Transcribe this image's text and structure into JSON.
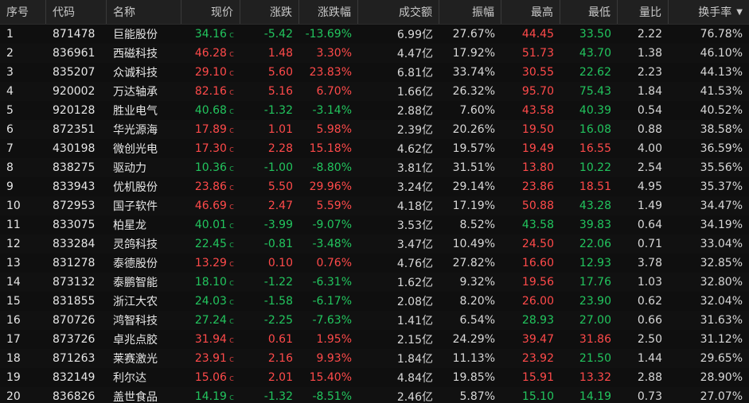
{
  "headers": [
    {
      "key": "idx",
      "label": "序号"
    },
    {
      "key": "code",
      "label": "代码"
    },
    {
      "key": "name",
      "label": "名称"
    },
    {
      "key": "price",
      "label": "现价"
    },
    {
      "key": "change",
      "label": "涨跌"
    },
    {
      "key": "pct",
      "label": "涨跌幅"
    },
    {
      "key": "turnover",
      "label": "成交额"
    },
    {
      "key": "amplitude",
      "label": "振幅"
    },
    {
      "key": "high",
      "label": "最高"
    },
    {
      "key": "low",
      "label": "最低"
    },
    {
      "key": "volratio",
      "label": "量比"
    },
    {
      "key": "turnrate",
      "label": "换手率",
      "sorted": "desc",
      "sort_icon": "▼"
    }
  ],
  "price_suffix": "c",
  "rows": [
    {
      "idx": "1",
      "code": "871478",
      "name": "巨能股份",
      "price": "34.16",
      "change": "-5.42",
      "pct": "-13.69%",
      "turnover": "6.99亿",
      "amplitude": "27.67%",
      "high": "44.45",
      "low": "33.50",
      "volratio": "2.22",
      "turnrate": "76.78%",
      "price_dir": "down",
      "change_dir": "down",
      "high_dir": "up",
      "low_dir": "down"
    },
    {
      "idx": "2",
      "code": "836961",
      "name": "西磁科技",
      "price": "46.28",
      "change": "1.48",
      "pct": "3.30%",
      "turnover": "4.47亿",
      "amplitude": "17.92%",
      "high": "51.73",
      "low": "43.70",
      "volratio": "1.38",
      "turnrate": "46.10%",
      "price_dir": "up",
      "change_dir": "up",
      "high_dir": "up",
      "low_dir": "down"
    },
    {
      "idx": "3",
      "code": "835207",
      "name": "众诚科技",
      "price": "29.10",
      "change": "5.60",
      "pct": "23.83%",
      "turnover": "6.81亿",
      "amplitude": "33.74%",
      "high": "30.55",
      "low": "22.62",
      "volratio": "2.23",
      "turnrate": "44.13%",
      "price_dir": "up",
      "change_dir": "up",
      "high_dir": "up",
      "low_dir": "down"
    },
    {
      "idx": "4",
      "code": "920002",
      "name": "万达轴承",
      "price": "82.16",
      "change": "5.16",
      "pct": "6.70%",
      "turnover": "1.66亿",
      "amplitude": "26.32%",
      "high": "95.70",
      "low": "75.43",
      "volratio": "1.84",
      "turnrate": "41.53%",
      "price_dir": "up",
      "change_dir": "up",
      "high_dir": "up",
      "low_dir": "down"
    },
    {
      "idx": "5",
      "code": "920128",
      "name": "胜业电气",
      "price": "40.68",
      "change": "-1.32",
      "pct": "-3.14%",
      "turnover": "2.88亿",
      "amplitude": "7.60%",
      "high": "43.58",
      "low": "40.39",
      "volratio": "0.54",
      "turnrate": "40.52%",
      "price_dir": "down",
      "change_dir": "down",
      "high_dir": "up",
      "low_dir": "down"
    },
    {
      "idx": "6",
      "code": "872351",
      "name": "华光源海",
      "price": "17.89",
      "change": "1.01",
      "pct": "5.98%",
      "turnover": "2.39亿",
      "amplitude": "20.26%",
      "high": "19.50",
      "low": "16.08",
      "volratio": "0.88",
      "turnrate": "38.58%",
      "price_dir": "up",
      "change_dir": "up",
      "high_dir": "up",
      "low_dir": "down"
    },
    {
      "idx": "7",
      "code": "430198",
      "name": "微创光电",
      "price": "17.30",
      "change": "2.28",
      "pct": "15.18%",
      "turnover": "4.62亿",
      "amplitude": "19.57%",
      "high": "19.49",
      "low": "16.55",
      "volratio": "4.00",
      "turnrate": "36.59%",
      "price_dir": "up",
      "change_dir": "up",
      "high_dir": "up",
      "low_dir": "up"
    },
    {
      "idx": "8",
      "code": "838275",
      "name": "驱动力",
      "price": "10.36",
      "change": "-1.00",
      "pct": "-8.80%",
      "turnover": "3.81亿",
      "amplitude": "31.51%",
      "high": "13.80",
      "low": "10.22",
      "volratio": "2.54",
      "turnrate": "35.56%",
      "price_dir": "down",
      "change_dir": "down",
      "high_dir": "up",
      "low_dir": "down"
    },
    {
      "idx": "9",
      "code": "833943",
      "name": "优机股份",
      "price": "23.86",
      "change": "5.50",
      "pct": "29.96%",
      "turnover": "3.24亿",
      "amplitude": "29.14%",
      "high": "23.86",
      "low": "18.51",
      "volratio": "4.95",
      "turnrate": "35.37%",
      "price_dir": "up",
      "change_dir": "up",
      "high_dir": "up",
      "low_dir": "up"
    },
    {
      "idx": "10",
      "code": "872953",
      "name": "国子软件",
      "price": "46.69",
      "change": "2.47",
      "pct": "5.59%",
      "turnover": "4.18亿",
      "amplitude": "17.19%",
      "high": "50.88",
      "low": "43.28",
      "volratio": "1.49",
      "turnrate": "34.47%",
      "price_dir": "up",
      "change_dir": "up",
      "high_dir": "up",
      "low_dir": "down"
    },
    {
      "idx": "11",
      "code": "833075",
      "name": "柏星龙",
      "price": "40.01",
      "change": "-3.99",
      "pct": "-9.07%",
      "turnover": "3.53亿",
      "amplitude": "8.52%",
      "high": "43.58",
      "low": "39.83",
      "volratio": "0.64",
      "turnrate": "34.19%",
      "price_dir": "down",
      "change_dir": "down",
      "high_dir": "down",
      "low_dir": "down"
    },
    {
      "idx": "12",
      "code": "833284",
      "name": "灵鸽科技",
      "price": "22.45",
      "change": "-0.81",
      "pct": "-3.48%",
      "turnover": "3.47亿",
      "amplitude": "10.49%",
      "high": "24.50",
      "low": "22.06",
      "volratio": "0.71",
      "turnrate": "33.04%",
      "price_dir": "down",
      "change_dir": "down",
      "high_dir": "up",
      "low_dir": "down"
    },
    {
      "idx": "13",
      "code": "831278",
      "name": "泰德股份",
      "price": "13.29",
      "change": "0.10",
      "pct": "0.76%",
      "turnover": "4.76亿",
      "amplitude": "27.82%",
      "high": "16.60",
      "low": "12.93",
      "volratio": "3.78",
      "turnrate": "32.85%",
      "price_dir": "up",
      "change_dir": "up",
      "high_dir": "up",
      "low_dir": "down"
    },
    {
      "idx": "14",
      "code": "873132",
      "name": "泰鹏智能",
      "price": "18.10",
      "change": "-1.22",
      "pct": "-6.31%",
      "turnover": "1.62亿",
      "amplitude": "9.32%",
      "high": "19.56",
      "low": "17.76",
      "volratio": "1.03",
      "turnrate": "32.80%",
      "price_dir": "down",
      "change_dir": "down",
      "high_dir": "up",
      "low_dir": "down"
    },
    {
      "idx": "15",
      "code": "831855",
      "name": "浙江大农",
      "price": "24.03",
      "change": "-1.58",
      "pct": "-6.17%",
      "turnover": "2.08亿",
      "amplitude": "8.20%",
      "high": "26.00",
      "low": "23.90",
      "volratio": "0.62",
      "turnrate": "32.04%",
      "price_dir": "down",
      "change_dir": "down",
      "high_dir": "up",
      "low_dir": "down"
    },
    {
      "idx": "16",
      "code": "870726",
      "name": "鸿智科技",
      "price": "27.24",
      "change": "-2.25",
      "pct": "-7.63%",
      "turnover": "1.41亿",
      "amplitude": "6.54%",
      "high": "28.93",
      "low": "27.00",
      "volratio": "0.66",
      "turnrate": "31.63%",
      "price_dir": "down",
      "change_dir": "down",
      "high_dir": "down",
      "low_dir": "down"
    },
    {
      "idx": "17",
      "code": "873726",
      "name": "卓兆点胶",
      "price": "31.94",
      "change": "0.61",
      "pct": "1.95%",
      "turnover": "2.15亿",
      "amplitude": "24.29%",
      "high": "39.47",
      "low": "31.86",
      "volratio": "2.50",
      "turnrate": "31.12%",
      "price_dir": "up",
      "change_dir": "up",
      "high_dir": "up",
      "low_dir": "up"
    },
    {
      "idx": "18",
      "code": "871263",
      "name": "莱赛激光",
      "price": "23.91",
      "change": "2.16",
      "pct": "9.93%",
      "turnover": "1.84亿",
      "amplitude": "11.13%",
      "high": "23.92",
      "low": "21.50",
      "volratio": "1.44",
      "turnrate": "29.65%",
      "price_dir": "up",
      "change_dir": "up",
      "high_dir": "up",
      "low_dir": "down"
    },
    {
      "idx": "19",
      "code": "832149",
      "name": "利尔达",
      "price": "15.06",
      "change": "2.01",
      "pct": "15.40%",
      "turnover": "4.84亿",
      "amplitude": "19.85%",
      "high": "15.91",
      "low": "13.32",
      "volratio": "2.88",
      "turnrate": "28.90%",
      "price_dir": "up",
      "change_dir": "up",
      "high_dir": "up",
      "low_dir": "up"
    },
    {
      "idx": "20",
      "code": "836826",
      "name": "盖世食品",
      "price": "14.19",
      "change": "-1.32",
      "pct": "-8.51%",
      "turnover": "2.46亿",
      "amplitude": "5.87%",
      "high": "15.10",
      "low": "14.19",
      "volratio": "0.73",
      "turnrate": "27.07%",
      "price_dir": "down",
      "change_dir": "down",
      "high_dir": "down",
      "low_dir": "down"
    }
  ],
  "colors": {
    "up": "#ff4a4a",
    "down": "#22c55e",
    "header_bg": "#202020",
    "bg": "#0f0f0f"
  }
}
